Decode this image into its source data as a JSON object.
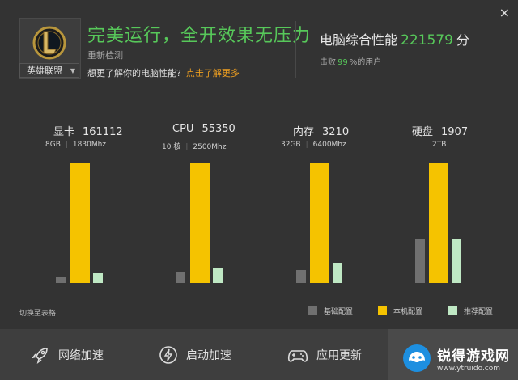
{
  "header": {
    "close": "×",
    "game_name": "英雄联盟",
    "status": "完美运行，全开效果无压力",
    "retest": "重新检测",
    "question": "想更了解你的电脑性能?",
    "learn_more": "点击了解更多",
    "score_label": "电脑综合性能",
    "score": "221579",
    "score_unit": "分",
    "beat_prefix": "击败",
    "beat_pct": "99",
    "beat_suffix": "%的用户"
  },
  "components": [
    {
      "name": "显卡",
      "score": "161112",
      "spec1": "8GB",
      "spec2": "1830Mhz",
      "base": 0.05,
      "local": 1.0,
      "rec": 0.08
    },
    {
      "name": "CPU",
      "score": "55350",
      "spec1": "10 核",
      "spec2": "2500Mhz",
      "base": 0.09,
      "local": 1.0,
      "rec": 0.13
    },
    {
      "name": "内存",
      "score": "3210",
      "spec1": "32GB",
      "spec2": "6400Mhz",
      "base": 0.11,
      "local": 1.0,
      "rec": 0.17
    },
    {
      "name": "硬盘",
      "score": "1907",
      "spec1": "2TB",
      "spec2": "",
      "base": 0.37,
      "local": 1.0,
      "rec": 0.37
    }
  ],
  "chart_data": {
    "type": "bar",
    "categories": [
      "显卡",
      "CPU",
      "内存",
      "硬盘"
    ],
    "series": [
      {
        "name": "基础配置",
        "values": [
          0.05,
          0.09,
          0.11,
          0.37
        ]
      },
      {
        "name": "本机配置",
        "values": [
          1.0,
          1.0,
          1.0,
          1.0
        ]
      },
      {
        "name": "推荐配置",
        "values": [
          0.08,
          0.13,
          0.17,
          0.37
        ]
      }
    ],
    "colors": {
      "base": "#707070",
      "local": "#f5c300",
      "rec": "#bfe8c4"
    }
  },
  "footer": {
    "switch_to_table": "切换至表格",
    "legend_base": "基础配置",
    "legend_local": "本机配置",
    "legend_rec": "推荐配置"
  },
  "nav": {
    "network": "网络加速",
    "startup": "启动加速",
    "update": "应用更新"
  },
  "watermark": {
    "title": "锐得游戏网",
    "url": "www.ytruido.com"
  },
  "colors": {
    "accent": "#57c85a",
    "link": "#f0a020",
    "bar_local": "#f5c300"
  }
}
